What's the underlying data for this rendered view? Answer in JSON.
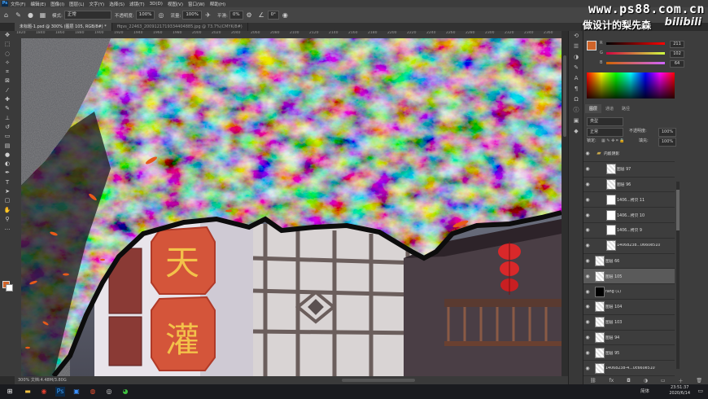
{
  "menubar": {
    "items": [
      "文件(F)",
      "编辑(E)",
      "图像(I)",
      "图层(L)",
      "文字(Y)",
      "选择(S)",
      "滤镜(T)",
      "3D(D)",
      "视图(V)",
      "窗口(W)",
      "帮助(H)"
    ]
  },
  "watermark": {
    "site": "www.ps88.com.cn",
    "author": "做设计的梨先森",
    "bilibili": "bilibili"
  },
  "options": {
    "mode_label": "模式:",
    "mode_value": "正常",
    "opacity_label": "不透明度:",
    "opacity_value": "100%",
    "flow_label": "流量:",
    "flow_value": "100%",
    "smooth_label": "平滑:",
    "smooth_value": "0%",
    "angle_value": "0°"
  },
  "tabs": [
    {
      "label": "未标题-1.psd @ 300% (图层 105, RGB/8#) *",
      "active": true
    },
    {
      "label": "ffqvs_22463_2009121719334404885.jpg @ 73.7%(CMYK/8#)",
      "active": false
    }
  ],
  "ruler_ticks": [
    "1820",
    "1840",
    "1860",
    "1880",
    "1900",
    "1920",
    "1940",
    "1960",
    "1980",
    "2000",
    "2020",
    "2040",
    "2060",
    "2080",
    "2100",
    "2120",
    "2140",
    "2160",
    "2180",
    "2200",
    "2220",
    "2240",
    "2260",
    "2280",
    "2300",
    "2320",
    "2340",
    "2360"
  ],
  "status": "300%   文档:4.48M/3.80G",
  "color_panel": {
    "sliders": [
      {
        "label": "R",
        "value": "211"
      },
      {
        "label": "G",
        "value": "102"
      },
      {
        "label": "B",
        "value": "64"
      }
    ],
    "fg_color": "#d0642a",
    "tabs": [
      "颜色",
      "色板"
    ]
  },
  "layers_panel": {
    "tabs": [
      "图层",
      "通道",
      "路径"
    ],
    "filter_label": "类型",
    "blend_mode": "正常",
    "opacity_label": "不透明度:",
    "opacity_value": "100%",
    "lock_label": "锁定:",
    "fill_label": "填充:",
    "fill_value": "100%",
    "layers": [
      {
        "name": "内嵌阴影",
        "thumb": "folder",
        "indent": 0,
        "selected": false
      },
      {
        "name": "图层 97",
        "thumb": "checker",
        "indent": 1,
        "selected": false
      },
      {
        "name": "图层 96",
        "thumb": "checker",
        "indent": 1,
        "selected": false
      },
      {
        "name": "1406...拷贝 11",
        "thumb": "white",
        "indent": 1,
        "selected": false
      },
      {
        "name": "1406...拷贝 10",
        "thumb": "white",
        "indent": 1,
        "selected": false
      },
      {
        "name": "1406...拷贝 9",
        "thumb": "white",
        "indent": 1,
        "selected": false
      },
      {
        "name": "14068238...0660e510",
        "thumb": "checker",
        "indent": 1,
        "selected": false
      },
      {
        "name": "图层 66",
        "thumb": "checker",
        "indent": 0,
        "selected": false
      },
      {
        "name": "图层 105",
        "thumb": "checker",
        "indent": 0,
        "selected": true
      },
      {
        "name": "fang (1)",
        "thumb": "black",
        "indent": 0,
        "selected": false
      },
      {
        "name": "图层 104",
        "thumb": "checker",
        "indent": 0,
        "selected": false
      },
      {
        "name": "图层 103",
        "thumb": "checker",
        "indent": 0,
        "selected": false
      },
      {
        "name": "图层 94",
        "thumb": "checker",
        "indent": 0,
        "selected": false
      },
      {
        "name": "图层 95",
        "thumb": "checker",
        "indent": 0,
        "selected": false
      },
      {
        "name": "14068238-4...0c660e510",
        "thumb": "checker",
        "indent": 0,
        "selected": false
      }
    ]
  },
  "canvas": {
    "sign_chars": [
      "天",
      "灌"
    ]
  },
  "taskbar": {
    "tray_text": "简体",
    "time": "23:51:37",
    "date": "2020/6/14"
  }
}
